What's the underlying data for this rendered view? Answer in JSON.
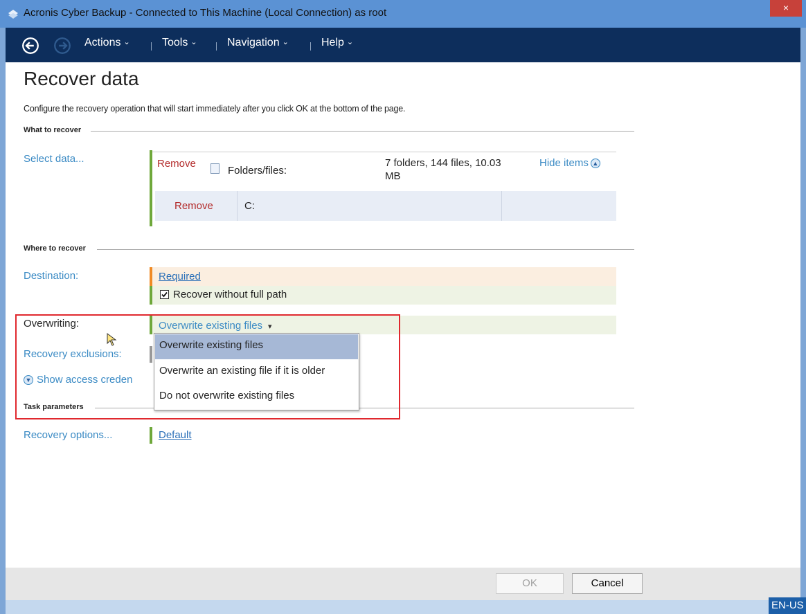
{
  "window": {
    "title": "Acronis Cyber Backup - Connected to This Machine (Local Connection) as root",
    "close_glyph": "×"
  },
  "toolbar": {
    "menus": [
      "Actions",
      "Tools",
      "Navigation",
      "Help"
    ],
    "chevron": "⌄"
  },
  "page": {
    "title": "Recover data",
    "intro": "Configure the recovery operation that will start immediately after you click OK at the bottom of the page."
  },
  "what_to_recover": {
    "header": "What to recover",
    "select_label": "Select data...",
    "remove_label": "Remove",
    "item_label": "Folders/files:",
    "summary_line1": "7 folders, 144 files, 10.03",
    "summary_line2": "MB",
    "hide_items_label": "Hide items",
    "subitem_remove_label": "Remove",
    "subitem_path": "C:"
  },
  "where_to_recover": {
    "header": "Where to recover",
    "destination_label": "Destination:",
    "destination_value": "Required",
    "full_path_checkbox_label": "Recover without full path",
    "full_path_checked": true,
    "overwriting_label": "Overwriting:",
    "overwriting_value": "Overwrite existing files",
    "dropdown_arrow": "▾",
    "overwriting_options": [
      "Overwrite existing files",
      "Overwrite an existing file if it is older",
      "Do not overwrite existing files"
    ],
    "selected_option_index": 0,
    "exclusions_label": "Recovery exclusions:",
    "show_credentials_label": "Show access creden"
  },
  "task_parameters": {
    "header": "Task parameters",
    "options_label": "Recovery options...",
    "options_value": "Default"
  },
  "footer": {
    "ok_label": "OK",
    "cancel_label": "Cancel"
  },
  "status": {
    "language": "EN-US"
  },
  "colors": {
    "title_bar": "#5b92d4",
    "toolbar": "#0d2e5c",
    "link": "#3a8ac4",
    "remove": "#b32b2b",
    "bar_green": "#6fa83b",
    "bar_orange": "#f08a24",
    "highlight": "#e0282e"
  }
}
